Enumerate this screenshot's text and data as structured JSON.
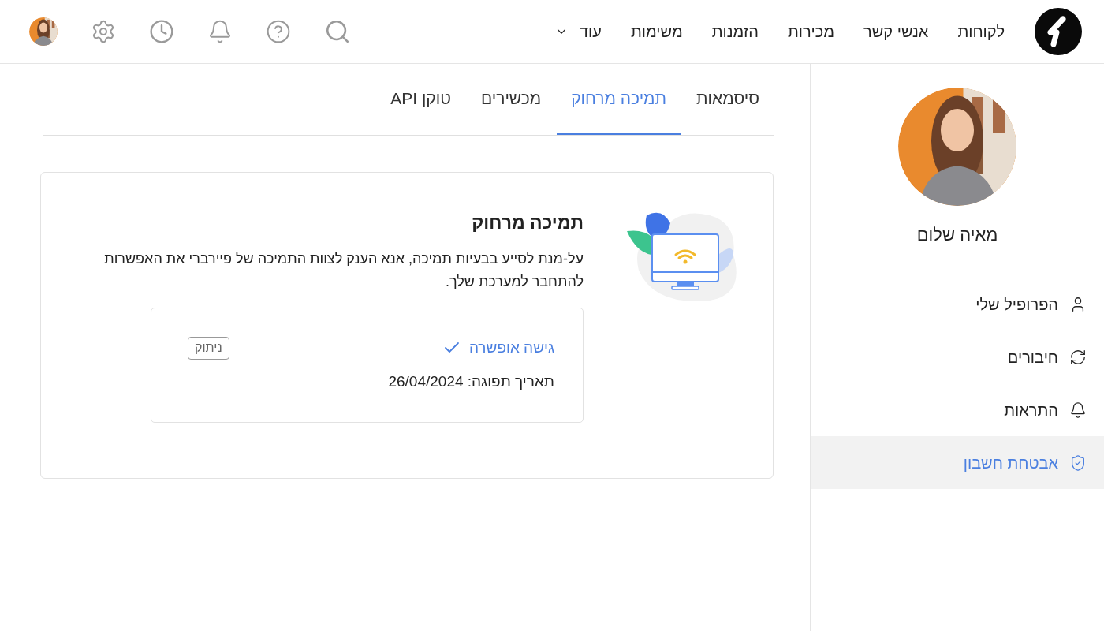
{
  "header": {
    "nav": [
      {
        "label": "לקוחות"
      },
      {
        "label": "אנשי קשר"
      },
      {
        "label": "מכירות"
      },
      {
        "label": "הזמנות"
      },
      {
        "label": "משימות"
      }
    ],
    "more": {
      "label": "עוד"
    }
  },
  "sidebar": {
    "user_name": "מאיה שלום",
    "items": [
      {
        "label": "הפרופיל שלי",
        "kind": "profile",
        "selected": false
      },
      {
        "label": "חיבורים",
        "kind": "sync",
        "selected": false
      },
      {
        "label": "התראות",
        "kind": "bell",
        "selected": false
      },
      {
        "label": "אבטחת חשבון",
        "kind": "shield",
        "selected": true
      }
    ]
  },
  "tabs": [
    {
      "label": "סיסמאות",
      "selected": false
    },
    {
      "label": "תמיכה מרחוק",
      "selected": true
    },
    {
      "label": "מכשירים",
      "selected": false
    },
    {
      "label": "טוקן API",
      "selected": false
    }
  ],
  "card": {
    "title": "תמיכה מרחוק",
    "description": "על-מנת לסייע בבעיות תמיכה, אנא הענק לצוות התמיכה של פיירברי את האפשרות להתחבר למערכת שלך.",
    "access": {
      "label": "גישה אופשרה",
      "enabled": true,
      "expiry": "תאריך תפוגה: 26/04/2024",
      "action": "ניתוק"
    }
  }
}
